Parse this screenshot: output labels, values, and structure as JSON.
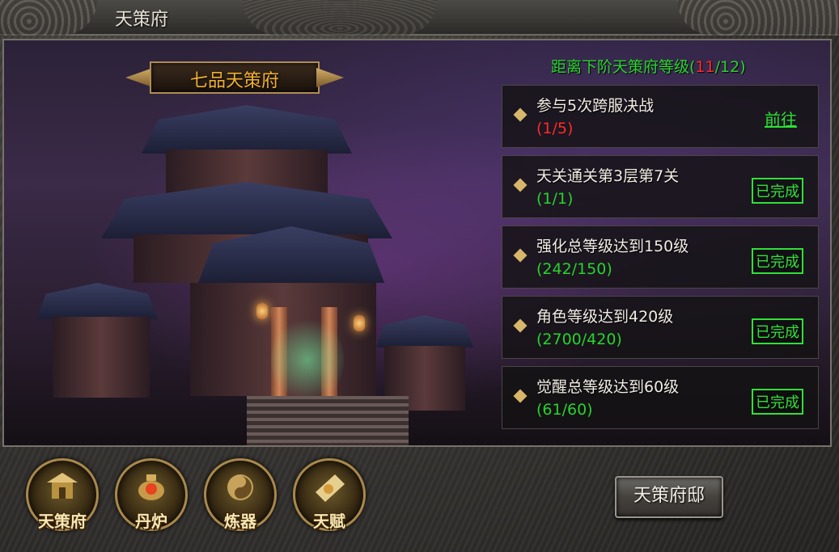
{
  "window": {
    "title": "天策府"
  },
  "rank": {
    "name": "七品天策府"
  },
  "next_level": {
    "prefix": "距离下阶天策府等级(",
    "current": "11",
    "rest": "/12)"
  },
  "tasks": [
    {
      "name": "参与5次跨服决战",
      "progress": "(1/5)",
      "status": "go",
      "action_label": "前往"
    },
    {
      "name": "天关通关第3层第7关",
      "progress": "(1/1)",
      "status": "done",
      "action_label": "已完成"
    },
    {
      "name": "强化总等级达到150级",
      "progress": "(242/150)",
      "status": "done",
      "action_label": "已完成"
    },
    {
      "name": "角色等级达到420级",
      "progress": "(2700/420)",
      "status": "done",
      "action_label": "已完成"
    },
    {
      "name": "觉醒总等级达到60级",
      "progress": "(61/60)",
      "status": "done",
      "action_label": "已完成"
    }
  ],
  "bottom_nav": [
    {
      "label": "天策府",
      "icon": "mansion-icon"
    },
    {
      "label": "丹炉",
      "icon": "furnace-icon"
    },
    {
      "label": "炼器",
      "icon": "forge-icon"
    },
    {
      "label": "天赋",
      "icon": "talent-scroll-icon"
    }
  ],
  "mansion_button": {
    "label": "天策府邸"
  },
  "colors": {
    "complete": "#30e038",
    "incomplete": "#ff2a2a",
    "title_gold": "#f0b030"
  }
}
